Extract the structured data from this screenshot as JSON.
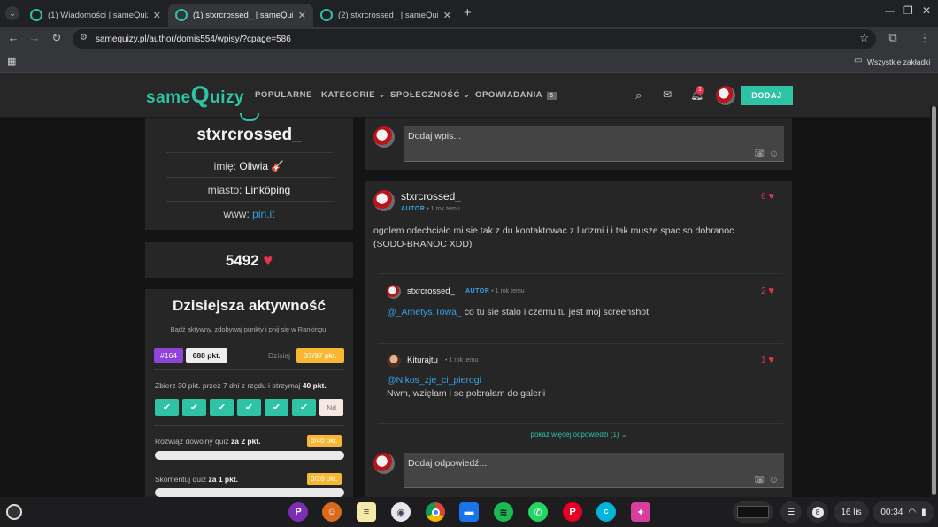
{
  "tabs": [
    {
      "title": "(1) Wiadomości | sameQuizy"
    },
    {
      "title": "(1) stxrcrossed_ | sameQuizy"
    },
    {
      "title": "(2) stxrcrossed_ | sameQuizy"
    }
  ],
  "url": "samequizy.pl/author/domis554/wpisy/?cpage=586",
  "bookmarks_label": "Wszystkie zakładki",
  "site": {
    "logo_a": "same",
    "logo_b": "Q",
    "logo_c": "uizy",
    "nav": [
      {
        "label": "POPULARNE"
      },
      {
        "label": "KATEGORIE ⌄"
      },
      {
        "label": "SPOŁECZNOŚĆ ⌄"
      },
      {
        "label": "OPOWIADANIA"
      }
    ],
    "stories_badge": "5",
    "notif_count": "1",
    "add_label": "DODAJ"
  },
  "profile": {
    "username": "stxrcrossed_",
    "name_label": "imię:",
    "name_value": "Oliwia 🎸",
    "city_label": "miasto:",
    "city_value": "Linköping",
    "www_label": "www:",
    "www_value": "pin.it",
    "hearts": "5492"
  },
  "activity": {
    "title": "Dzisiejsza aktywność",
    "subtitle": "Bądź aktywny, zdobywaj punkty i pnij się w Rankingu!",
    "rank": "#164",
    "points": "688 pkt.",
    "today_label": "Dzisiaj",
    "today_value": "37/97 pkt.",
    "streak_text_a": "Zbierz 30 pkt. przez 7 dni z rzędu i otrzymaj ",
    "streak_text_b": "40 pkt.",
    "streak_last": "Nd",
    "task1_text_a": "Rozwiąż dowolny quiz ",
    "task1_text_b": "za 2 pkt.",
    "task1_badge": "0/40 pkt.",
    "task1_progress": 0,
    "task2_text_a": "Skomentuj quiz ",
    "task2_text_b": "za 1 pkt.",
    "task2_badge": "0/20 pkt.",
    "task2_progress": 0
  },
  "composer": {
    "placeholder": "Dodaj wpis..."
  },
  "post": {
    "author": "stxrcrossed_",
    "badge": "AUTOR",
    "time": "• 1 rok temu",
    "likes": "6",
    "text": "ogolem odechciało mi sie tak z du kontaktowac z ludzmi i i tak musze spac so dobranoc (SODO-BRANOC XDD)"
  },
  "replies": [
    {
      "author": "stxrcrossed_",
      "badge": "AUTOR",
      "time": "• 1 rok temu",
      "likes": "2",
      "mention": "@_Ametys.Towa_",
      "text": " co tu sie stalo i czemu tu jest moj screenshot"
    },
    {
      "author": "Kiturajtu",
      "time": "• 1 rok temu",
      "likes": "1",
      "mention": "@Nikos_zje_ci_pierogi",
      "text": "Nwm, wzięłam i se pobrałam do galerii"
    }
  ],
  "more_replies": "pokaż więcej odpowiedzi (1) ⌄",
  "reply_placeholder": "Dodaj odpowiedź...",
  "taskbar": {
    "notif_count": "8",
    "date": "16 lis",
    "time": "00:34"
  },
  "colors": {
    "accent": "#2fc3a6",
    "link": "#36a3e6",
    "heart": "#e8344f",
    "rank_badge": "#8e44d6",
    "warn": "#f7b733"
  }
}
